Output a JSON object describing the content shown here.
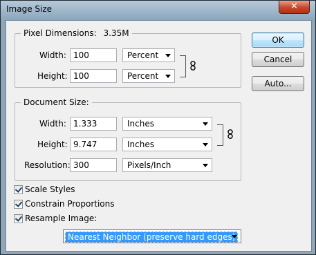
{
  "window": {
    "title": "Image Size",
    "close_glyph": "✕"
  },
  "pixel_dimensions": {
    "legend": "Pixel Dimensions:",
    "size": "3.35M",
    "width_label": "Width:",
    "width_value": "100",
    "width_unit": "Percent",
    "height_label": "Height:",
    "height_value": "100",
    "height_unit": "Percent"
  },
  "document_size": {
    "legend": "Document Size:",
    "width_label": "Width:",
    "width_value": "1.333",
    "width_unit": "Inches",
    "height_label": "Height:",
    "height_value": "9.747",
    "height_unit": "Inches",
    "resolution_label": "Resolution:",
    "resolution_value": "300",
    "resolution_unit": "Pixels/Inch"
  },
  "buttons": {
    "ok": "OK",
    "cancel": "Cancel",
    "auto": "Auto..."
  },
  "options": {
    "scale_styles": {
      "label": "Scale Styles",
      "checked": true
    },
    "constrain": {
      "label": "Constrain Proportions",
      "checked": true
    },
    "resample": {
      "label": "Resample Image:",
      "checked": true
    }
  },
  "resample_method": "Nearest Neighbor (preserve hard edges)"
}
